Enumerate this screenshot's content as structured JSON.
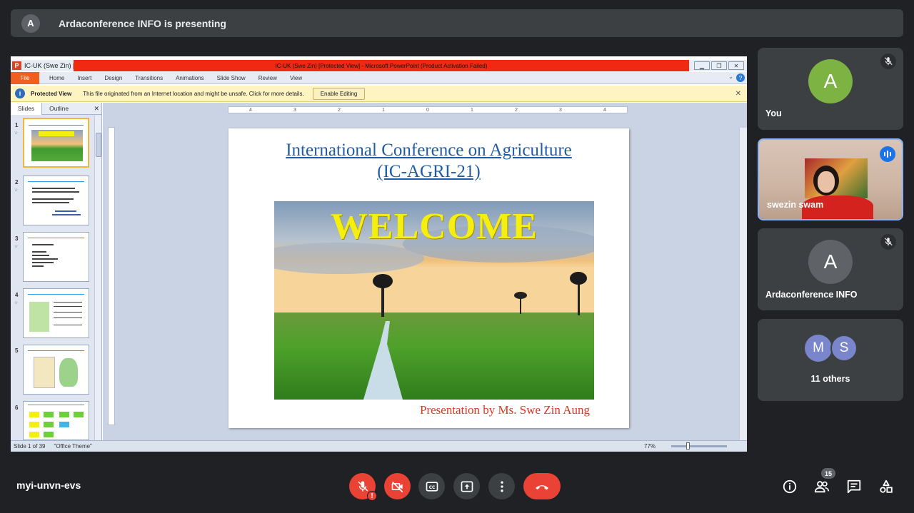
{
  "banner": {
    "avatar_letter": "A",
    "text": "Ardaconference INFO is presenting"
  },
  "ppt": {
    "app_icon": "P",
    "doc_tab": "IC-UK (Swe Zin) [",
    "window_title": "IC-UK (Swe Zin) [Protected View]  -  Microsoft PowerPoint (Product Activation Failed)",
    "ribbon_tabs": [
      "File",
      "Home",
      "Insert",
      "Design",
      "Transitions",
      "Animations",
      "Slide Show",
      "Review",
      "View"
    ],
    "protected": {
      "label": "Protected View",
      "message": "This file originated from an Internet location and might be unsafe. Click for more details.",
      "button": "Enable Editing"
    },
    "panel_tabs": {
      "slides": "Slides",
      "outline": "Outline"
    },
    "thumb_numbers": [
      "1",
      "2",
      "3",
      "4",
      "5",
      "6"
    ],
    "ruler_marks": [
      "4",
      "3",
      "2",
      "1",
      "0",
      "1",
      "2",
      "3",
      "4"
    ],
    "slide": {
      "title_line1": "International  Conference on Agriculture",
      "title_line2": "(IC-AGRI-21)",
      "welcome": "WELCOME",
      "presenter": "Presentation by Ms. Swe Zin Aung"
    },
    "status": {
      "slide_count": "Slide 1 of 39",
      "theme": "\"Office Theme\"",
      "zoom": "77%"
    }
  },
  "participants": {
    "you": {
      "letter": "A",
      "name": "You",
      "color": "#7cb342"
    },
    "speaker": {
      "name": "swezin swam"
    },
    "presenter": {
      "letter": "A",
      "name": "Ardaconference INFO",
      "color": "#5f6368"
    },
    "others": {
      "letters": [
        "M",
        "S"
      ],
      "label": "11 others",
      "colors": [
        "#7986cb",
        "#7986cb"
      ]
    }
  },
  "bottom": {
    "meeting_code": "myi-unvn-evs",
    "people_count": "15"
  },
  "icons": [
    "mic-off-icon",
    "camera-off-icon",
    "captions-icon",
    "present-icon",
    "more-icon",
    "end-call-icon",
    "info-icon",
    "people-icon",
    "chat-icon",
    "activities-icon"
  ]
}
